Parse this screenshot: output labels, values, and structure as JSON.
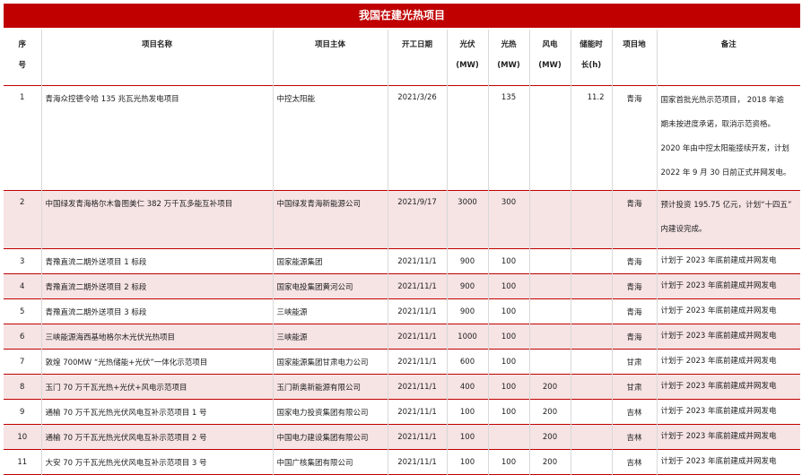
{
  "title": "我国在建光热项目",
  "headers": {
    "no_1": "序",
    "no_2": "号",
    "name": "项目名称",
    "owner": "项目主体",
    "start": "开工日期",
    "pv_1": "光伏",
    "pv_2": "(MW)",
    "csp_1": "光热",
    "csp_2": "(MW)",
    "wind_1": "风电",
    "wind_2": "(MW)",
    "storage_1": "储能时",
    "storage_2": "长(h)",
    "location": "项目地",
    "note": "备注"
  },
  "rows": [
    {
      "no": "1",
      "name": "青海众控德令哈 135 兆瓦光热发电项目",
      "owner": "中控太阳能",
      "start": "2021/3/26",
      "pv": "",
      "csp": "135",
      "wind": "",
      "storage": "11.2",
      "location": "青海",
      "note": [
        "国家首批光热示范项目， 2018 年逾",
        "期未按进度承诺，取消示范资格。",
        "2020 年由中控太阳能接续开发，计划",
        "2022 年 9 月 30 日前正式并网发电。"
      ]
    },
    {
      "no": "2",
      "name": "中国绿发青海格尔木鲁图美仁 382 万千瓦多能互补项目",
      "owner": "中国绿发青海新能源公司",
      "start": "2021/9/17",
      "pv": "3000",
      "csp": "300",
      "wind": "",
      "storage": "",
      "location": "青海",
      "note": [
        "预计投资 195.75 亿元，计划“十四五”",
        "内建设完成。"
      ]
    },
    {
      "no": "3",
      "name": "青豫直流二期外送项目 1 标段",
      "owner": "国家能源集团",
      "start": "2021/11/1",
      "pv": "900",
      "csp": "100",
      "wind": "",
      "storage": "",
      "location": "青海",
      "note": [
        "计划于 2023 年底前建成并网发电"
      ]
    },
    {
      "no": "4",
      "name": "青豫直流二期外送项目 2 标段",
      "owner": "国家电投集团黄河公司",
      "start": "2021/11/1",
      "pv": "900",
      "csp": "100",
      "wind": "",
      "storage": "",
      "location": "青海",
      "note": [
        "计划于 2023 年底前建成并网发电"
      ]
    },
    {
      "no": "5",
      "name": "青豫直流二期外送项目 3 标段",
      "owner": "三峡能源",
      "start": "2021/11/1",
      "pv": "900",
      "csp": "100",
      "wind": "",
      "storage": "",
      "location": "青海",
      "note": [
        "计划于 2023 年底前建成并网发电"
      ]
    },
    {
      "no": "6",
      "name": "三峡能源海西基地格尔木光伏光热项目",
      "owner": "三峡能源",
      "start": "2021/11/1",
      "pv": "1000",
      "csp": "100",
      "wind": "",
      "storage": "",
      "location": "青海",
      "note": [
        "计划于 2023 年底前建成并网发电"
      ]
    },
    {
      "no": "7",
      "name": "敦煌 700MW “光热储能+光伏”一体化示范项目",
      "owner": "国家能源集团甘肃电力公司",
      "start": "2021/11/1",
      "pv": "600",
      "csp": "100",
      "wind": "",
      "storage": "",
      "location": "甘肃",
      "note": [
        "计划于 2023 年底前建成并网发电"
      ]
    },
    {
      "no": "8",
      "name": "玉门 70 万千瓦光热+光伏+风电示范项目",
      "owner": "玉门新奥新能源有限公司",
      "start": "2021/11/1",
      "pv": "400",
      "csp": "100",
      "wind": "200",
      "storage": "",
      "location": "甘肃",
      "note": [
        "计划于 2023 年底前建成并网发电"
      ]
    },
    {
      "no": "9",
      "name": "通榆 70 万千瓦光热光伏风电互补示范项目 1 号",
      "owner": "国家电力投资集团有限公司",
      "start": "2021/11/1",
      "pv": "100",
      "csp": "100",
      "wind": "200",
      "storage": "",
      "location": "吉林",
      "note": [
        "计划于 2023 年底前建成并网发电"
      ]
    },
    {
      "no": "10",
      "name": "通榆 70 万千瓦光热光伏风电互补示范项目 2 号",
      "owner": "中国电力建设集团有限公司",
      "start": "2021/11/1",
      "pv": "100",
      "csp": "",
      "wind": "200",
      "storage": "",
      "location": "吉林",
      "note": [
        "计划于 2023 年底前建成并网发电"
      ]
    },
    {
      "no": "11",
      "name": "大安 70 万千瓦光热光伏风电互补示范项目 3 号",
      "owner": "中国广核集团有限公司",
      "start": "2021/11/1",
      "pv": "100",
      "csp": "100",
      "wind": "200",
      "storage": "",
      "location": "吉林",
      "note": [
        "计划于 2023 年底前建成并网发电"
      ]
    }
  ]
}
